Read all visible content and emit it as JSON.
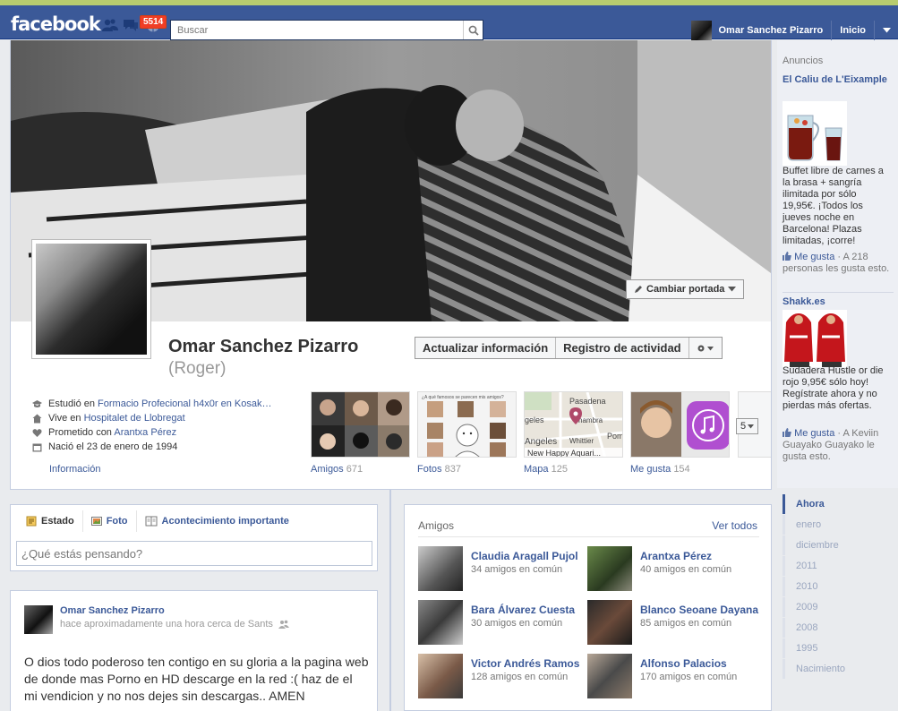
{
  "topbar": {
    "logo": "facebook",
    "notif_count": "5514",
    "search_placeholder": "Buscar",
    "user_name": "Omar Sanchez Pizarro",
    "home": "Inicio",
    "icons": [
      "friend-requests-icon",
      "messages-icon",
      "notifications-icon",
      "search-icon",
      "chevron-down-icon"
    ]
  },
  "profile": {
    "name": "Omar Sanchez Pizarro",
    "nickname": "(Roger)",
    "change_cover": "Cambiar portada",
    "actions": {
      "update_info": "Actualizar información",
      "activity_log": "Registro de actividad"
    },
    "info": {
      "studied_prefix": "Estudió en",
      "studied_link": "Formacio Profecional h4x0r en Kosak…",
      "lives_prefix": "Vive en",
      "lives_link": "Hospitalet de Llobregat",
      "engaged_prefix": "Prometido con",
      "engaged_link": "Arantxa Pérez",
      "born": "Nació el 23 de enero de 1994",
      "link": "Información"
    },
    "tiles": [
      {
        "label": "Amigos",
        "count": "671"
      },
      {
        "label": "Fotos",
        "count": "837"
      },
      {
        "label": "Mapa",
        "count": "125"
      },
      {
        "label": "Me gusta",
        "count": "154"
      }
    ],
    "tiles_more": "5",
    "map_text": {
      "city1": "Pasadena",
      "city2": "geles",
      "city3": "hambra",
      "city4": "Angeles",
      "city5": "Whittier",
      "city6": "Pom",
      "place": "New Happy Aquari..."
    },
    "photos_header": "¿A qué famosos se parecen mis amigos?"
  },
  "composer": {
    "tabs": [
      "Estado",
      "Foto",
      "Acontecimiento importante"
    ],
    "placeholder": "¿Qué estás pensando?"
  },
  "story": {
    "author": "Omar Sanchez Pizarro",
    "meta": "hace aproximadamente una hora cerca de Sants",
    "text": "O dios todo poderoso ten contigo en su gloria a la pagina web de donde mas Porno en HD descarge en la red :( haz de el mi vendicion y no nos dejes sin descargas.. AMEN"
  },
  "friends": {
    "title": "Amigos",
    "see_all": "Ver todos",
    "list": [
      {
        "name": "Claudia Aragall Pujol",
        "mutual": "34 amigos en común"
      },
      {
        "name": "Arantxa Pérez",
        "mutual": "40 amigos en común"
      },
      {
        "name": "Bara Álvarez Cuesta",
        "mutual": "30 amigos en común"
      },
      {
        "name": "Blanco Seoane Dayana",
        "mutual": "85 amigos en común"
      },
      {
        "name": "Victor Andrés Ramos",
        "mutual": "128 amigos en común"
      },
      {
        "name": "Alfonso Palacios",
        "mutual": "170 amigos en común"
      }
    ]
  },
  "ads": {
    "title": "Anuncios",
    "items": [
      {
        "title": "El Caliu de L'Eixample",
        "body": "Buffet libre de carnes a la brasa + sangría ilimitada por sólo 19,95€. ¡Todos los jueves noche en Barcelona! Plazas limitadas, ¡corre!",
        "like": "Me gusta",
        "social": "· A 218 personas les gusta esto."
      },
      {
        "title": "Shakk.es",
        "body": "Sudadera Hustle or die rojo 9,95€ sólo hoy! Regístrate ahora y no pierdas más ofertas.",
        "like": "Me gusta",
        "social": "· A Keviin Guayako Guayako le gusta esto."
      }
    ]
  },
  "timeline_years": [
    "Ahora",
    "enero",
    "diciembre",
    "2011",
    "2010",
    "2009",
    "2008",
    "1995",
    "Nacimiento"
  ],
  "colors": {
    "brand": "#3b5998",
    "bar_dark": "#133783",
    "badge": "#f03d25",
    "strip": "#b8cc6e"
  }
}
